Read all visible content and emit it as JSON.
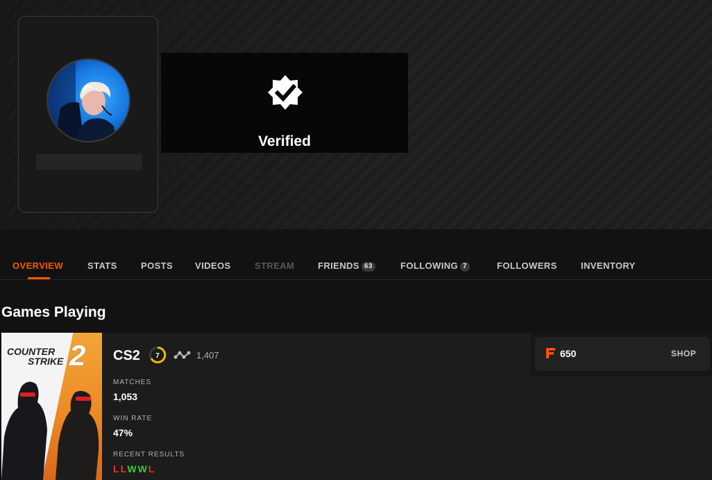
{
  "profile": {
    "badge": {
      "label": "Verified",
      "icon": "verified-icon"
    }
  },
  "tabs": [
    {
      "label": "OVERVIEW",
      "state": "active"
    },
    {
      "label": "STATS",
      "state": "normal"
    },
    {
      "label": "POSTS",
      "state": "normal"
    },
    {
      "label": "VIDEOS",
      "state": "normal"
    },
    {
      "label": "STREAM",
      "state": "disabled"
    },
    {
      "label": "FRIENDS",
      "count": "63",
      "state": "normal"
    },
    {
      "label": "FOLLOWING",
      "count": "7",
      "state": "normal"
    },
    {
      "label": "FOLLOWERS",
      "state": "normal"
    },
    {
      "label": "INVENTORY",
      "state": "normal"
    }
  ],
  "games_section": {
    "title": "Games Playing",
    "game": {
      "cover_logo_line1": "COUNTER",
      "cover_logo_line2": "STRIKE",
      "cover_logo_number": "2",
      "name": "CS2",
      "level": "7",
      "elo": "1,407",
      "stats": [
        {
          "label": "MATCHES",
          "value": "1,053"
        },
        {
          "label": "WIN RATE",
          "value": "47%"
        }
      ],
      "recent_results_label": "RECENT RESULTS",
      "recent_results": [
        "L",
        "L",
        "W",
        "W",
        "L"
      ]
    },
    "shop": {
      "points": "650",
      "button_label": "SHOP"
    }
  },
  "colors": {
    "accent": "#ff5500",
    "win": "#33cc33",
    "loss": "#ff2a2a",
    "level_ring": "#f5b800"
  }
}
